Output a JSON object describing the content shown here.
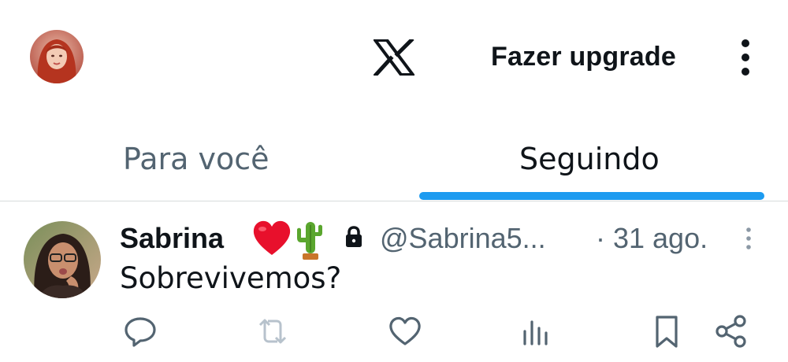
{
  "header": {
    "avatar_icon": "profile-avatar",
    "logo_icon": "x-logo-icon",
    "upgrade_label": "Fazer upgrade",
    "more_icon": "more-vertical-icon"
  },
  "tabs": [
    {
      "label": "Para você",
      "active": false
    },
    {
      "label": "Seguindo",
      "active": true
    }
  ],
  "accent_color": "#1d9bf0",
  "tweet": {
    "name": "Sabrina",
    "name_emojis": [
      "red-heart-emoji",
      "cactus-emoji"
    ],
    "protected_icon": "lock-icon",
    "handle": "@Sabrina5...",
    "time": "· 31 ago.",
    "text": "Sobrevivemos?",
    "actions": [
      "reply-icon",
      "retweet-icon",
      "like-icon",
      "views-icon",
      "bookmark-icon",
      "share-icon"
    ]
  }
}
